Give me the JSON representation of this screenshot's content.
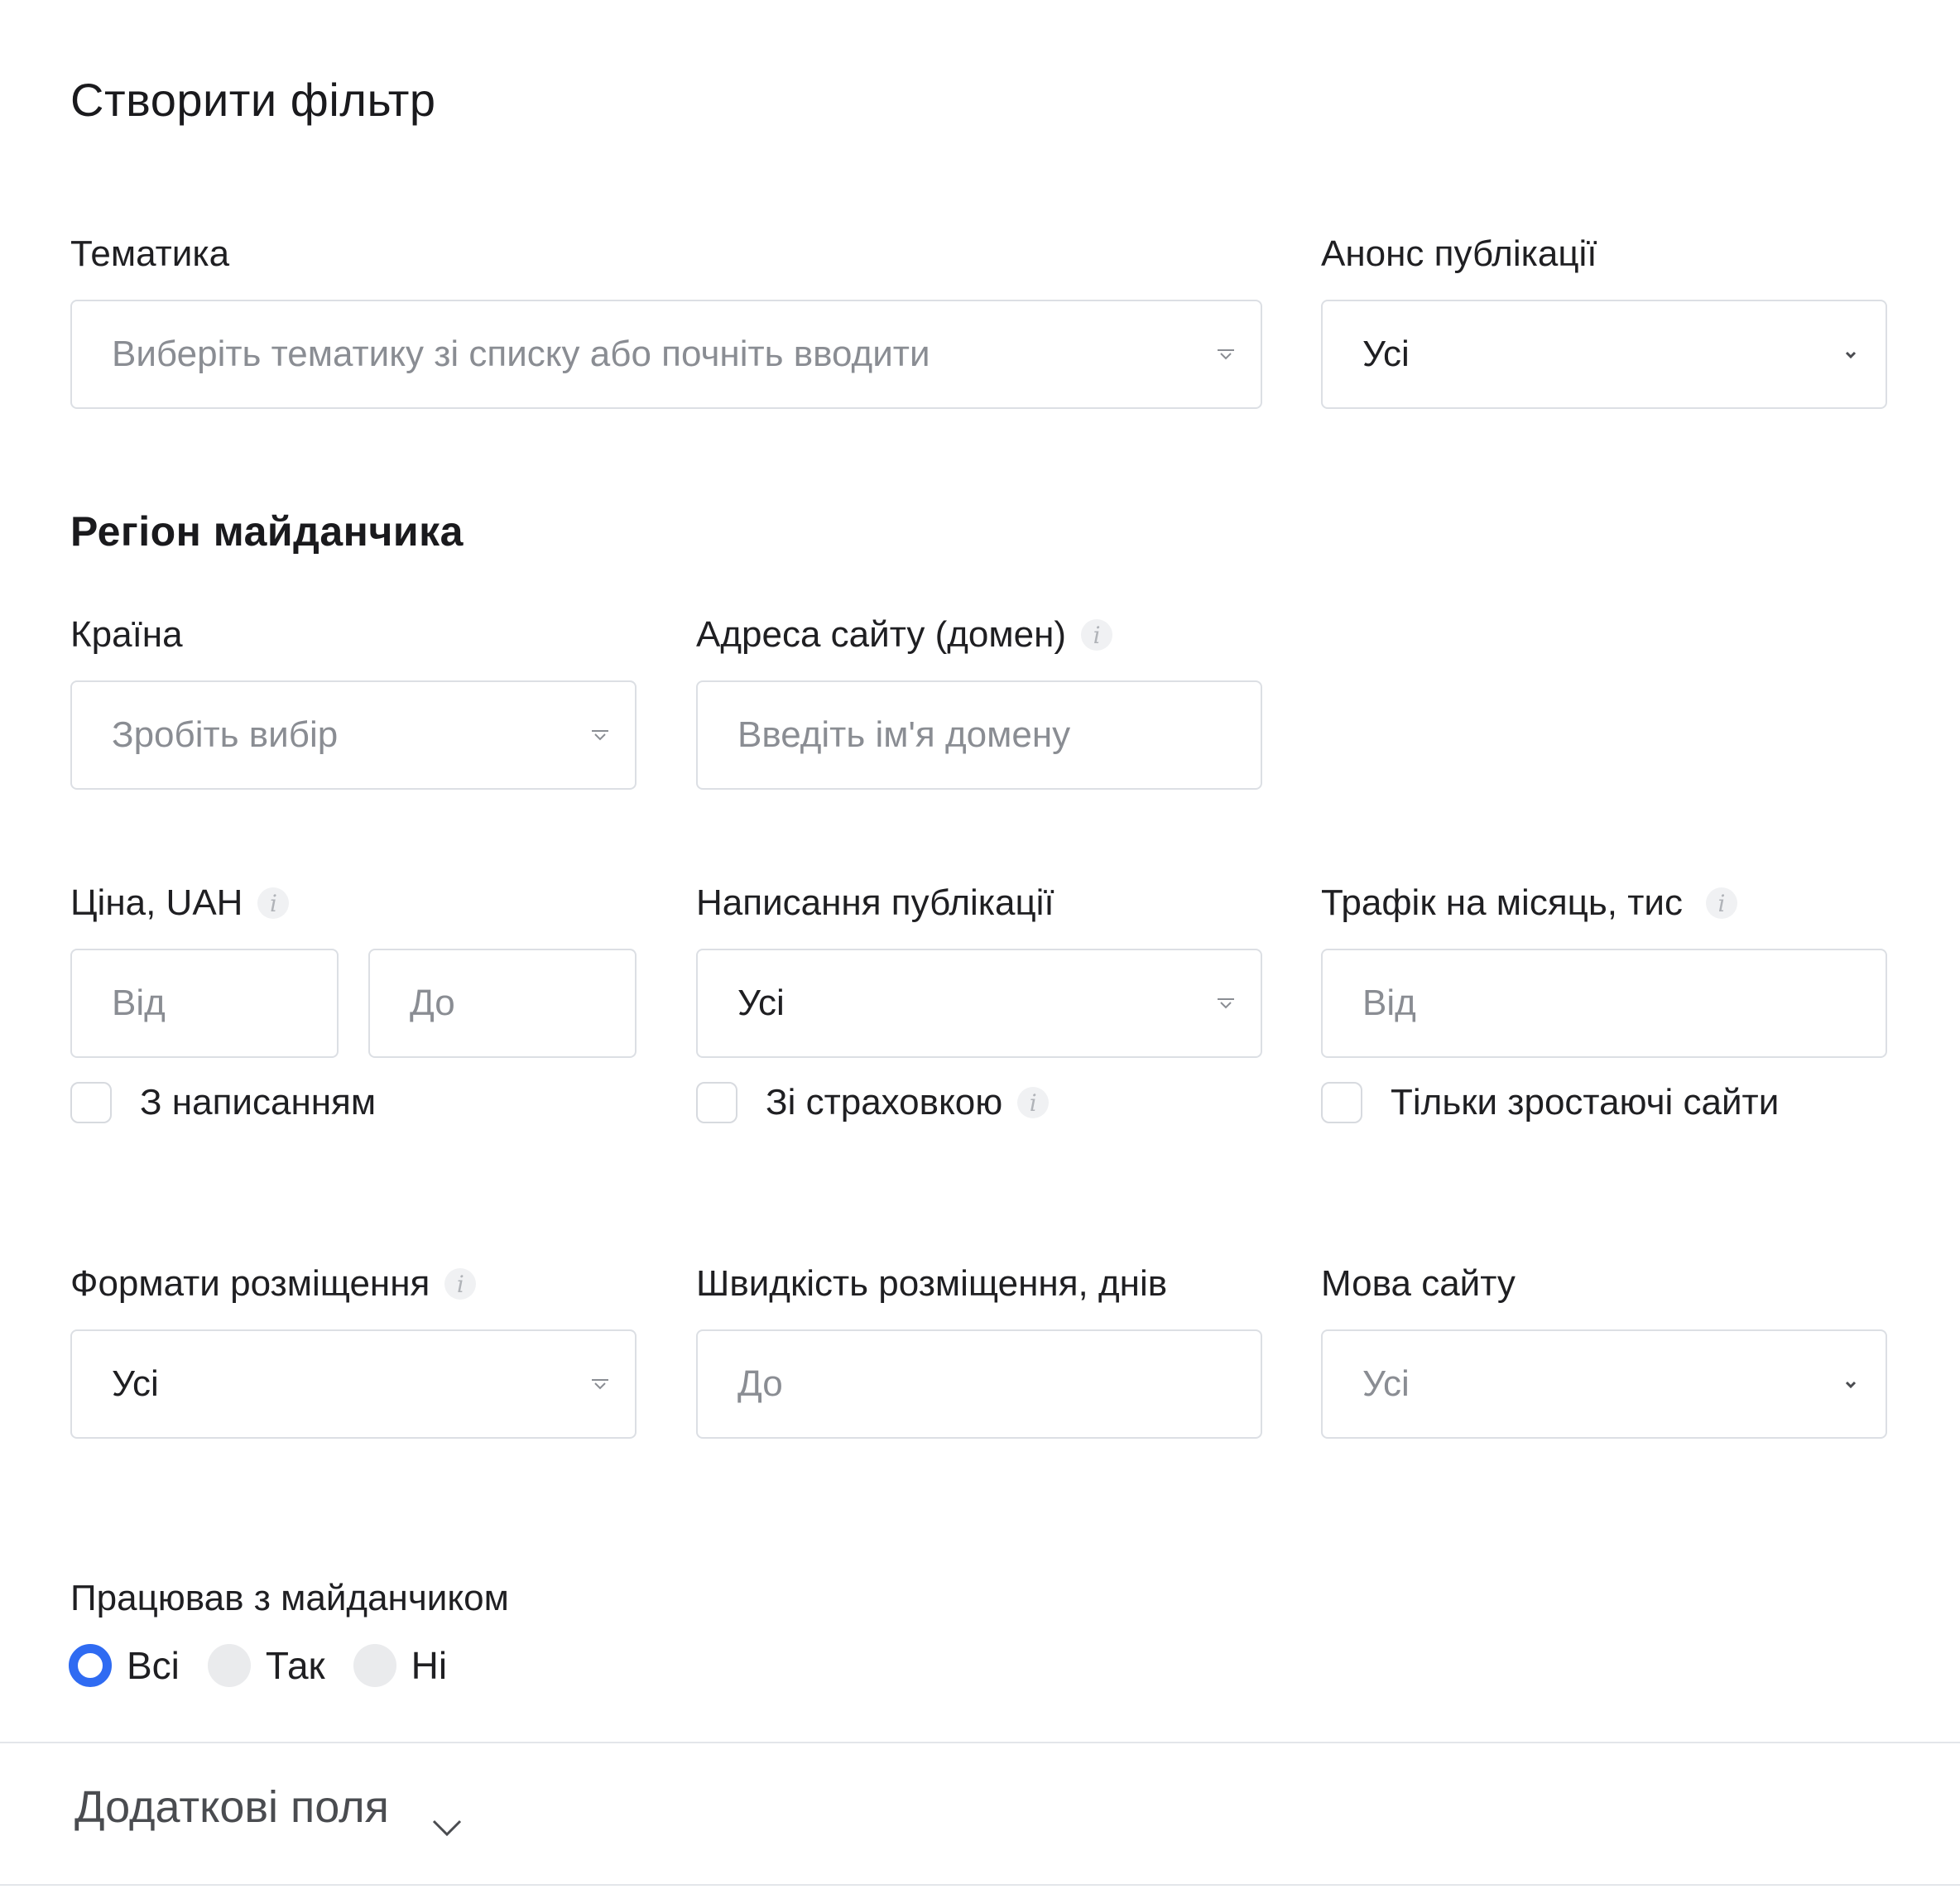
{
  "title": "Створити фільтр",
  "topic": {
    "label": "Тематика",
    "placeholder": "Виберіть тематику зі списку або почніть вводити"
  },
  "announce": {
    "label": "Анонс публікації",
    "value": "Усі"
  },
  "region_section": "Регіон майданчика",
  "country": {
    "label": "Країна",
    "placeholder": "Зробіть вибір"
  },
  "domain": {
    "label": "Адреса сайту (домен)",
    "placeholder": "Введіть ім'я домену"
  },
  "price": {
    "label": "Ціна, UAH",
    "from_placeholder": "Від",
    "to_placeholder": "До",
    "checkbox_label": "З написанням"
  },
  "writing": {
    "label": "Написання публікації",
    "value": "Усі",
    "checkbox_label": "Зі страховкою"
  },
  "traffic": {
    "label": "Трафік на місяць, тис",
    "from_placeholder": "Від",
    "checkbox_label": "Тільки зростаючі сайти"
  },
  "formats": {
    "label": "Формати розміщення",
    "value": "Усі"
  },
  "speed": {
    "label": "Швидкість розміщення, днів",
    "placeholder": "До"
  },
  "language": {
    "label": "Мова сайту",
    "placeholder": "Усі"
  },
  "worked": {
    "label": "Працював з майданчиком",
    "options": [
      "Всі",
      "Так",
      "Ні"
    ],
    "selected": "Всі"
  },
  "extra_fields": "Додаткові поля",
  "colors": {
    "accent": "#2f6bf2",
    "border": "#dcdfe4",
    "placeholder": "#8a8d93"
  }
}
